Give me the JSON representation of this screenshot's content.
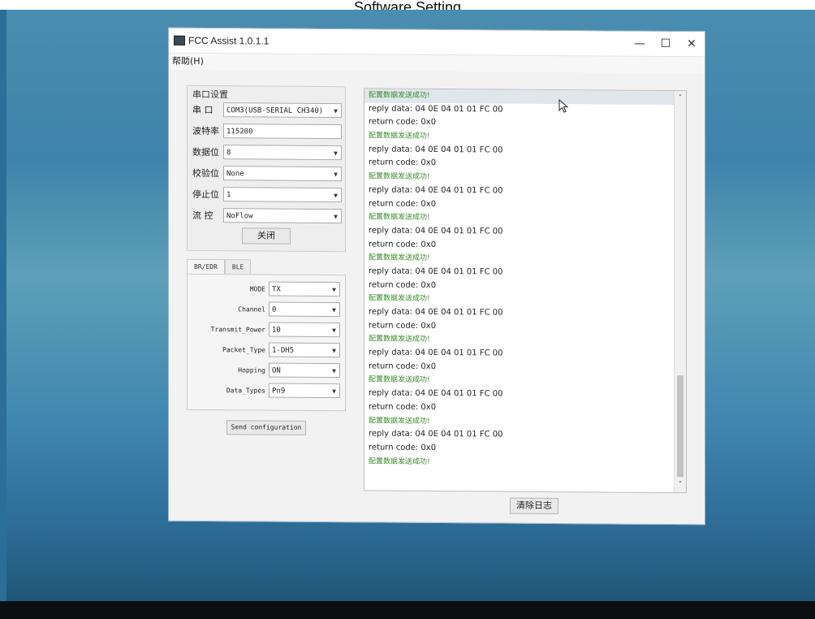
{
  "caption": "Software Setting",
  "window": {
    "title": "FCC Assist 1.0.1.1",
    "minimize_glyph": "—",
    "maximize_glyph": "☐",
    "close_glyph": "✕"
  },
  "menu": {
    "help": "帮助(H)"
  },
  "serial": {
    "group_title": "串口设置",
    "port_label": "串  口",
    "port_value": "COM3(USB-SERIAL CH340)",
    "baud_label": "波特率",
    "baud_value": "115200",
    "databits_label": "数据位",
    "databits_value": "8",
    "parity_label": "校验位",
    "parity_value": "None",
    "stopbits_label": "停止位",
    "stopbits_value": "1",
    "flow_label": "流  控",
    "flow_value": "NoFlow",
    "close_button": "关闭"
  },
  "tabs": [
    "BR/EDR",
    "BLE"
  ],
  "config": {
    "mode_label": "MODE",
    "mode_value": "TX",
    "channel_label": "Channel",
    "channel_value": "0",
    "power_label": "Transmit_Power",
    "power_value": "10",
    "packet_label": "Packet_Type",
    "packet_value": "1-DH5",
    "hopping_label": "Hopping",
    "hopping_value": "ON",
    "datatypes_label": "Data_Types",
    "datatypes_value": "Pn9",
    "send_button": "Send configuration"
  },
  "log": [
    {
      "text": "配置数据发送成功!",
      "kind": "success"
    },
    {
      "text": "reply data: 04 0E 04 01 01 FC 00",
      "kind": "reply"
    },
    {
      "text": "return code: 0x0",
      "kind": "code"
    },
    {
      "text": "配置数据发送成功!",
      "kind": "success"
    },
    {
      "text": "reply data: 04 0E 04 01 01 FC 00",
      "kind": "reply"
    },
    {
      "text": "return code: 0x0",
      "kind": "code"
    },
    {
      "text": "配置数据发送成功!",
      "kind": "success"
    },
    {
      "text": "reply data: 04 0E 04 01 01 FC 00",
      "kind": "reply"
    },
    {
      "text": "return code: 0x0",
      "kind": "code"
    },
    {
      "text": "配置数据发送成功!",
      "kind": "success"
    },
    {
      "text": "reply data: 04 0E 04 01 01 FC 00",
      "kind": "reply"
    },
    {
      "text": "return code: 0x0",
      "kind": "code"
    },
    {
      "text": "配置数据发送成功!",
      "kind": "success"
    },
    {
      "text": "reply data: 04 0E 04 01 01 FC 00",
      "kind": "reply"
    },
    {
      "text": "return code: 0x0",
      "kind": "code"
    },
    {
      "text": "配置数据发送成功!",
      "kind": "success"
    },
    {
      "text": "reply data: 04 0E 04 01 01 FC 00",
      "kind": "reply"
    },
    {
      "text": "return code: 0x0",
      "kind": "code"
    },
    {
      "text": "配置数据发送成功!",
      "kind": "success"
    },
    {
      "text": "reply data: 04 0E 04 01 01 FC 00",
      "kind": "reply"
    },
    {
      "text": "return code: 0x0",
      "kind": "code"
    },
    {
      "text": "配置数据发送成功!",
      "kind": "success"
    },
    {
      "text": "reply data: 04 0E 04 01 01 FC 00",
      "kind": "reply"
    },
    {
      "text": "return code: 0x0",
      "kind": "code"
    },
    {
      "text": "配置数据发送成功!",
      "kind": "success"
    },
    {
      "text": "reply data: 04 0E 04 01 01 FC 00",
      "kind": "reply"
    },
    {
      "text": "return code: 0x0",
      "kind": "code"
    },
    {
      "text": "配置数据发送成功!",
      "kind": "success"
    }
  ],
  "clear_button": "清除日志",
  "scroll": {
    "up_glyph": "˄",
    "down_glyph": "˅"
  }
}
